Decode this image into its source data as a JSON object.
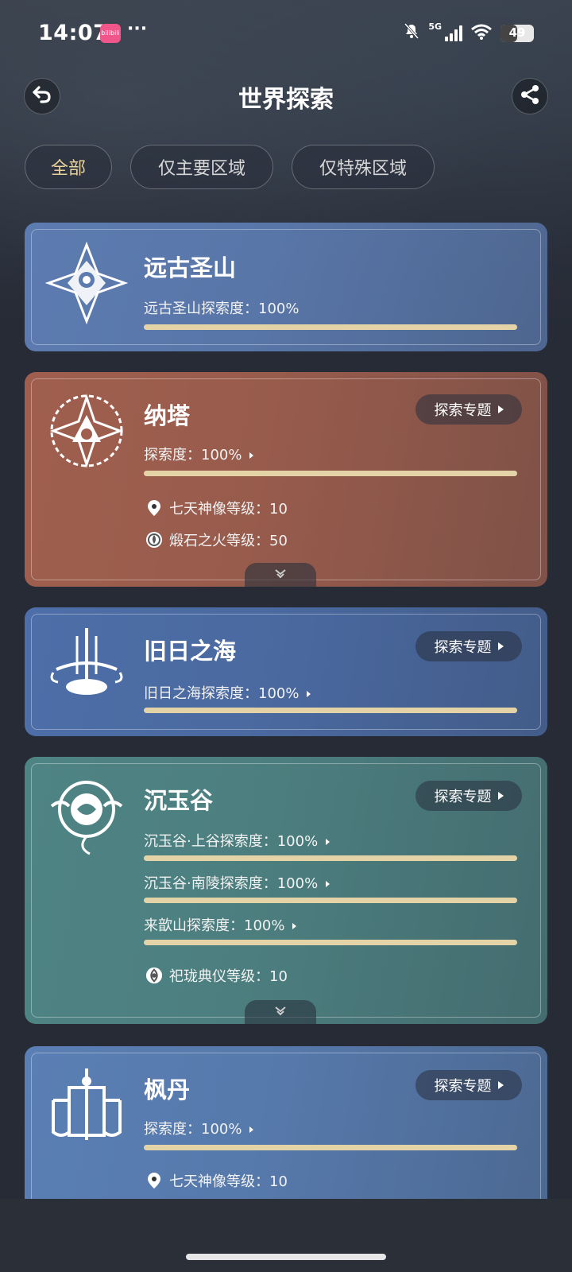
{
  "status_bar": {
    "time": "14:07",
    "app_badge": "bilibili",
    "more": "···",
    "network": "5G",
    "battery": "49",
    "battery_level": 0.49
  },
  "header": {
    "title": "世界探索",
    "back_icon": "back-arrow-icon",
    "share_icon": "share-icon"
  },
  "filters": [
    {
      "label": "全部",
      "active": true
    },
    {
      "label": "仅主要区域",
      "active": false
    },
    {
      "label": "仅特殊区域",
      "active": false
    }
  ],
  "topic_button_label": "探索专题",
  "cards": [
    {
      "title": "远古圣山",
      "color": "#5c7bb0",
      "progress": [
        {
          "label": "远古圣山探索度：",
          "value": "100%",
          "fraction": 1.0
        }
      ]
    },
    {
      "title": "纳塔",
      "color": "#a05f4e",
      "progress": [
        {
          "label": "探索度：",
          "value": "100%",
          "fraction": 1.0
        }
      ],
      "levels": [
        {
          "icon": "location-pin-icon",
          "text": "七天神像等级：10"
        },
        {
          "icon": "forge-fire-icon",
          "text": "煅石之火等级：50"
        }
      ]
    },
    {
      "title": "旧日之海",
      "color": "#4d6ea8",
      "progress": [
        {
          "label": "旧日之海探索度：",
          "value": "100%",
          "fraction": 1.0
        }
      ]
    },
    {
      "title": "沉玉谷",
      "color": "#4f8484",
      "progress": [
        {
          "label": "沉玉谷·上谷探索度：",
          "value": "100%",
          "fraction": 1.0
        },
        {
          "label": "沉玉谷·南陵探索度：",
          "value": "100%",
          "fraction": 1.0
        },
        {
          "label": "来歆山探索度：",
          "value": "100%",
          "fraction": 1.0
        }
      ],
      "levels": [
        {
          "icon": "ritual-icon",
          "text": "祀珑典仪等级：10"
        }
      ]
    },
    {
      "title": "枫丹",
      "color": "#5a7fb4",
      "progress": [
        {
          "label": "探索度：",
          "value": "100%",
          "fraction": 1.0
        }
      ],
      "levels": [
        {
          "icon": "location-pin-icon",
          "text": "七天神像等级：10"
        }
      ]
    }
  ]
}
